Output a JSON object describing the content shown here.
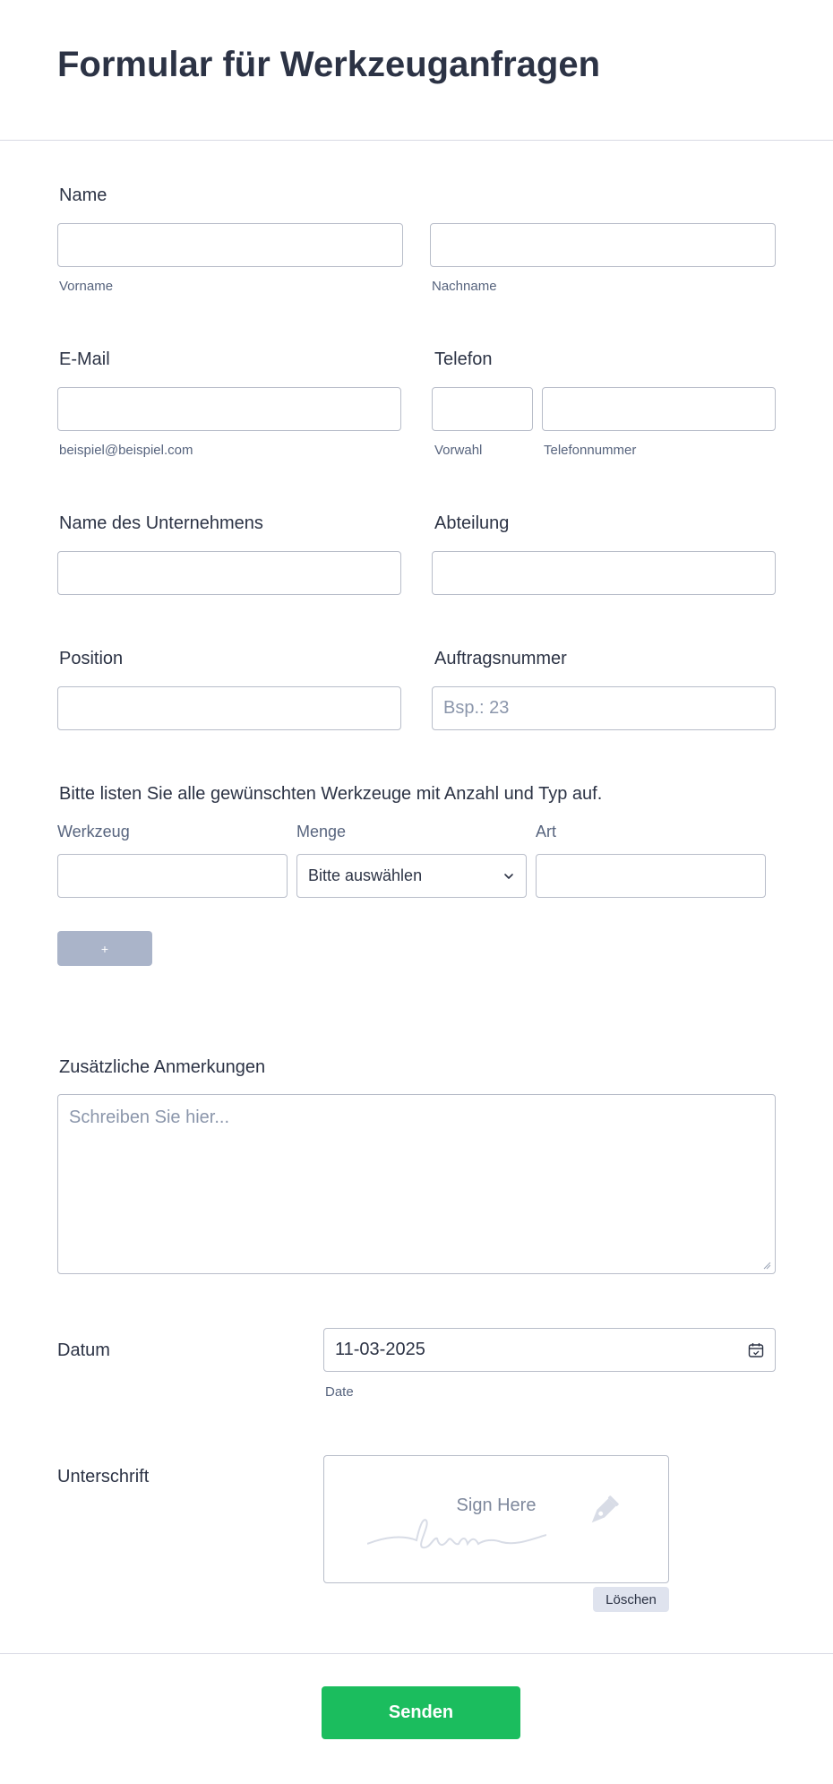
{
  "form": {
    "title": "Formular für Werkzeuganfragen"
  },
  "name": {
    "label": "Name",
    "first_sublabel": "Vorname",
    "last_sublabel": "Nachname"
  },
  "email": {
    "label": "E-Mail",
    "sublabel": "beispiel@beispiel.com"
  },
  "phone": {
    "label": "Telefon",
    "area_sublabel": "Vorwahl",
    "number_sublabel": "Telefonnummer"
  },
  "company": {
    "label": "Name des Unternehmens"
  },
  "department": {
    "label": "Abteilung"
  },
  "position": {
    "label": "Position"
  },
  "order_number": {
    "label": "Auftragsnummer",
    "placeholder": "Bsp.: 23"
  },
  "tools": {
    "question": "Bitte listen Sie alle gewünschten Werkzeuge mit Anzahl und Typ auf.",
    "columns": [
      "Werkzeug",
      "Menge",
      "Art"
    ],
    "quantity_selected": "Bitte auswählen",
    "add_label": "+"
  },
  "notes": {
    "label": "Zusätzliche Anmerkungen",
    "placeholder": "Schreiben Sie hier..."
  },
  "date": {
    "label": "Datum",
    "value": "11-03-2025",
    "sublabel": "Date"
  },
  "signature": {
    "label": "Unterschrift",
    "prompt": "Sign Here",
    "clear_label": "Löschen"
  },
  "submit": {
    "label": "Senden"
  },
  "colors": {
    "accent": "#1bbd5e",
    "text": "#2c3345",
    "border": "#b8bdc9"
  }
}
